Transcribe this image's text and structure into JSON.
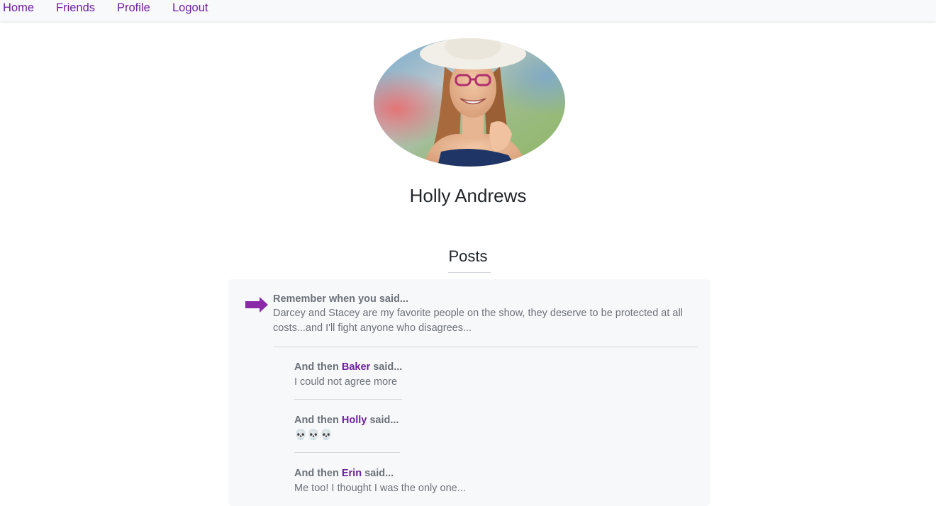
{
  "nav": {
    "home": "Home",
    "friends": "Friends",
    "profile": "Profile",
    "logout": "Logout"
  },
  "profile": {
    "name": "Holly Andrews",
    "avatar_icon": "profile-photo"
  },
  "posts": {
    "heading": "Posts",
    "items": [
      {
        "icon": "right-arrow-icon",
        "title": "Remember when you said...",
        "body": "Darcey and Stacey are my favorite people on the show, they deserve to be protected at all costs...and I'll fight anyone who disagrees...",
        "replies": [
          {
            "prefix": "And then ",
            "user": "Baker",
            "suffix": " said...",
            "body": "I could not agree more"
          },
          {
            "prefix": "And then ",
            "user": "Holly",
            "suffix": " said...",
            "body": "💀💀💀"
          },
          {
            "prefix": "And then ",
            "user": "Erin",
            "suffix": " said...",
            "body": "Me too! I thought I was the only one..."
          }
        ]
      }
    ]
  },
  "colors": {
    "accent": "#6f1fa3",
    "arrow": "#8b2aa8",
    "muted_text": "#6c727a",
    "card_bg": "#f7f8f9",
    "navbar_bg": "#f8f9fa"
  }
}
